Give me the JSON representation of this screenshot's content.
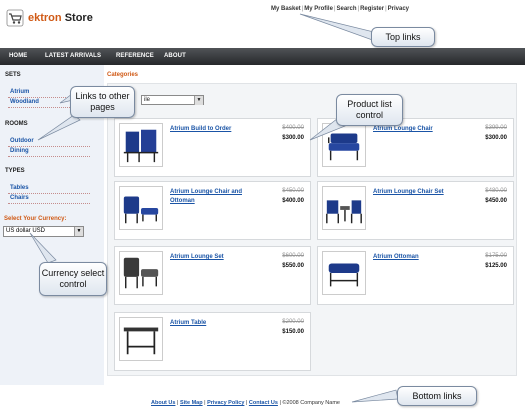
{
  "header": {
    "logo_brand": "ektron",
    "logo_suffix": "Store",
    "top_links": [
      "My Basket",
      "My Profile",
      "Search",
      "Register",
      "Privacy"
    ]
  },
  "nav": {
    "items": [
      "HOME",
      "LATEST ARRIVALS",
      "REFERENCE",
      "ABOUT"
    ]
  },
  "sidebar": {
    "sets_heading": "SETS",
    "sets": [
      "Atrium",
      "Woodland"
    ],
    "rooms_heading": "ROOMS",
    "rooms": [
      "Outdoor",
      "Dining"
    ],
    "types_heading": "TYPES",
    "types": [
      "Tables",
      "Chairs"
    ],
    "currency_label": "Select Your Currency:",
    "currency_value": "US dollar USD"
  },
  "main": {
    "categories_label": "Categories",
    "sort_value": "ile"
  },
  "products": [
    {
      "name": "Atrium Build to Order",
      "old_price": "$400.00",
      "price": "$300.00",
      "icon": "chair-set-icon"
    },
    {
      "name": "Atrium Lounge Chair",
      "old_price": "$399.00",
      "price": "$300.00",
      "icon": "lounge-chair-icon"
    },
    {
      "name": "Atrium Lounge Chair and Ottoman",
      "old_price": "$450.00",
      "price": "$400.00",
      "icon": "chair-ottoman-icon"
    },
    {
      "name": "Atrium Lounge Chair Set",
      "old_price": "$480.00",
      "price": "$450.00",
      "icon": "chair-set-icon"
    },
    {
      "name": "Atrium Lounge Set",
      "old_price": "$600.00",
      "price": "$550.00",
      "icon": "lounge-set-icon"
    },
    {
      "name": "Atrium Ottoman",
      "old_price": "$175.00",
      "price": "$125.00",
      "icon": "ottoman-icon"
    },
    {
      "name": "Atrium Table",
      "old_price": "$200.00",
      "price": "$150.00",
      "icon": "table-icon"
    }
  ],
  "footer": {
    "links": [
      "About Us",
      "Site Map",
      "Privacy Policy",
      "Contact Us"
    ],
    "copyright": "©2008 Company Name"
  },
  "callouts": {
    "top_links": "Top links",
    "links_other": "Links to other pages",
    "product_list": "Product list control",
    "currency": "Currency select control",
    "bottom_links": "Bottom links"
  },
  "colors": {
    "accent_orange": "#d05a16",
    "link_blue": "#1a54a6",
    "nav_dark": "#2a2c2f",
    "sidebar_bg": "#eef2f8"
  }
}
